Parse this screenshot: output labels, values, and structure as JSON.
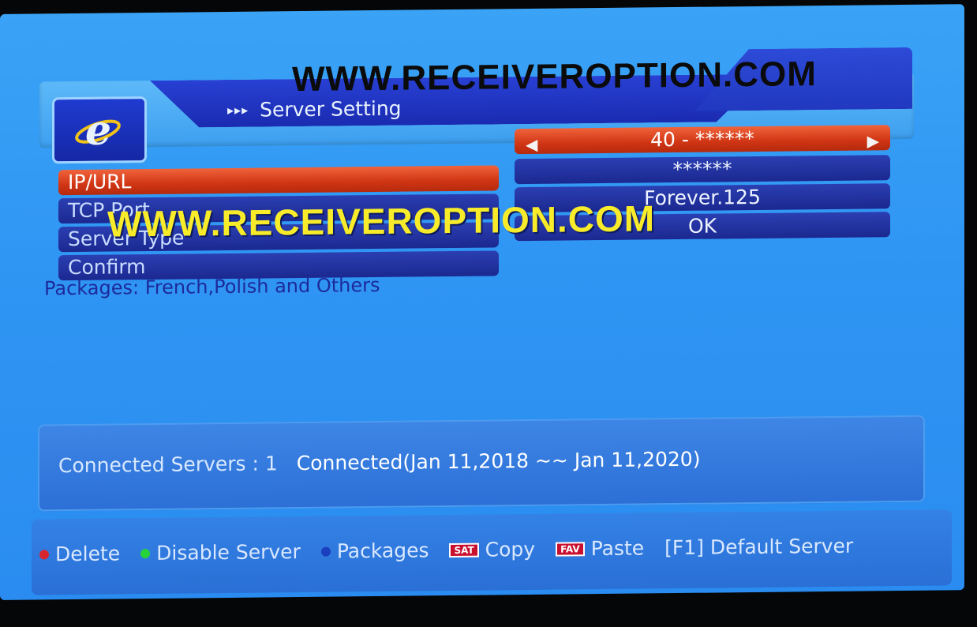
{
  "header": {
    "title": "Server Setting",
    "title_arrows": "▸▸▸",
    "logo_icon": "internet-explorer-logo-icon"
  },
  "watermarks": {
    "top": "WWW.RECEIVEROPTION.COM",
    "middle": "WWW.RECEIVEROPTION.COM"
  },
  "settings": {
    "rows": [
      {
        "label": "IP/URL",
        "value": "******",
        "selected": true
      },
      {
        "label": "TCP Port",
        "value": "******",
        "selected": false
      },
      {
        "label": "Server Type",
        "value": "Forever.125",
        "selected": false
      },
      {
        "label": "Confirm",
        "value": "OK",
        "selected": false
      }
    ],
    "server_selector": "40 - ******"
  },
  "packages": "Packages: French,Polish and Others",
  "status": {
    "connected": "Connected Servers : 1",
    "date_range": "Connected(Jan 11,2018 ~~ Jan 11,2020)"
  },
  "footer": {
    "delete": "Delete",
    "disable": "Disable Server",
    "packages": "Packages",
    "sat_badge": "SAT",
    "copy": "Copy",
    "fav_badge": "FAV",
    "paste": "Paste",
    "default_server": "[F1] Default Server"
  },
  "colors": {
    "selected_row": "#d03514",
    "row_bg": "#1f2ea0",
    "screen_bg": "#2f95f3",
    "red_key": "#d6272e",
    "green_key": "#27d33a",
    "blue_key": "#1a3fbf"
  }
}
